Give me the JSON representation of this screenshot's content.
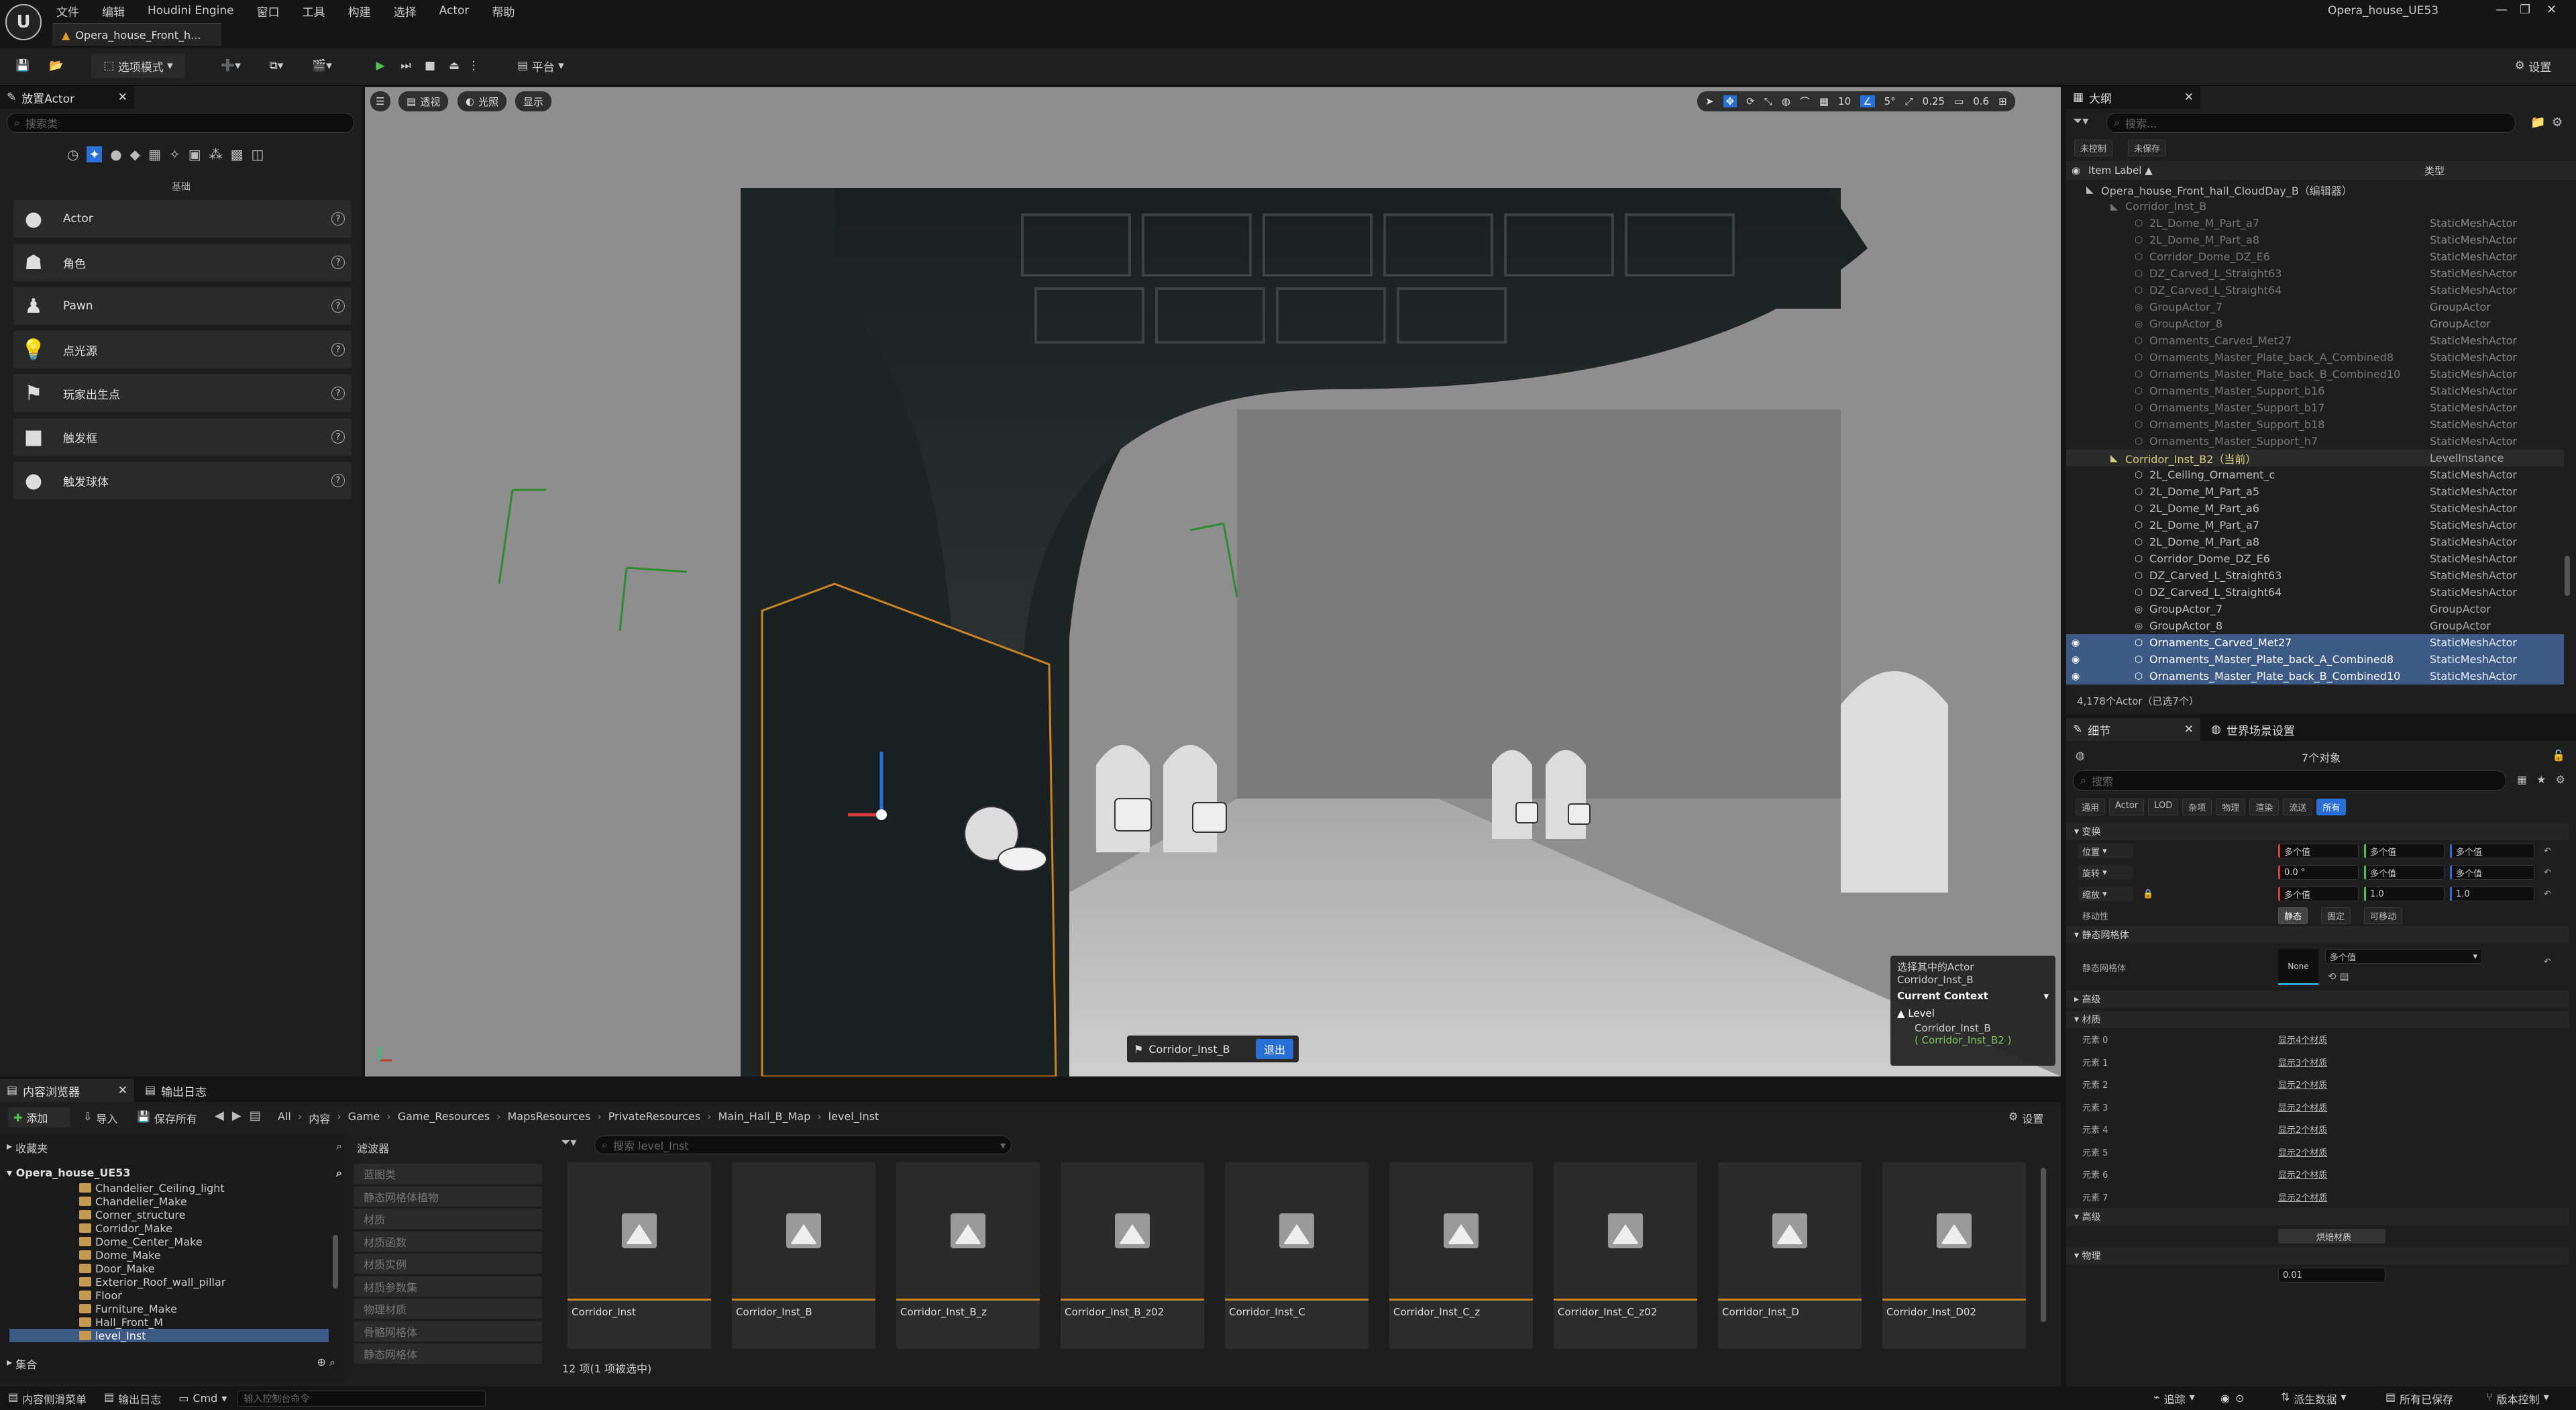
{
  "menu": [
    "文件",
    "编辑",
    "Houdini Engine",
    "窗口",
    "工具",
    "构建",
    "选择",
    "Actor",
    "帮助"
  ],
  "app": {
    "project": "Opera_house_UE53",
    "doc_tab": "Opera_house_Front_h..."
  },
  "toolbar": {
    "mode": "选项模式",
    "platform": "平台",
    "settings": "设置"
  },
  "place": {
    "tab": "放置Actor",
    "search_placeholder": "搜索类",
    "category": "基础",
    "items": [
      {
        "label": "Actor",
        "icon": "sphere-icon"
      },
      {
        "label": "角色",
        "icon": "character-icon"
      },
      {
        "label": "Pawn",
        "icon": "pawn-icon"
      },
      {
        "label": "点光源",
        "icon": "point-light-icon"
      },
      {
        "label": "玩家出生点",
        "icon": "player-start-icon"
      },
      {
        "label": "触发框",
        "icon": "trigger-box-icon"
      },
      {
        "label": "触发球体",
        "icon": "trigger-sphere-icon"
      }
    ]
  },
  "viewport": {
    "perspective": "透视",
    "lit": "光照",
    "show": "显示",
    "grid": "10",
    "angle": "5°",
    "scale": "0.25",
    "camera": "0.6",
    "level_chip": "Corridor_Inst_B",
    "exit_button": "退出",
    "context": {
      "sel_label": "选择其中的Actor",
      "sel_value": "Corridor_Inst_B",
      "title": "Current Context",
      "level": "Level",
      "level_name": "Corridor_Inst_B",
      "level_sub": "( Corridor_Inst_B2 )"
    }
  },
  "outliner": {
    "tab": "大纲",
    "search_placeholder": "搜索...",
    "filter_a": "未控制",
    "filter_b": "未保存",
    "col_label": "Item Label ▲",
    "col_type": "类型",
    "rows": [
      {
        "indent": 1,
        "icon": "◣",
        "name": "Opera_house_Front_hall_CloudDay_B（编辑器）",
        "type": "",
        "style": ""
      },
      {
        "indent": 2,
        "icon": "◣",
        "name": "Corridor_Inst_B",
        "type": "",
        "style": "dim"
      },
      {
        "indent": 3,
        "icon": "⬡",
        "name": "2L_Dome_M_Part_a7",
        "type": "StaticMeshActor",
        "style": "dim"
      },
      {
        "indent": 3,
        "icon": "⬡",
        "name": "2L_Dome_M_Part_a8",
        "type": "StaticMeshActor",
        "style": "dim"
      },
      {
        "indent": 3,
        "icon": "⬡",
        "name": "Corridor_Dome_DZ_E6",
        "type": "StaticMeshActor",
        "style": "dim"
      },
      {
        "indent": 3,
        "icon": "⬡",
        "name": "DZ_Carved_L_Straight63",
        "type": "StaticMeshActor",
        "style": "dim"
      },
      {
        "indent": 3,
        "icon": "⬡",
        "name": "DZ_Carved_L_Straight64",
        "type": "StaticMeshActor",
        "style": "dim"
      },
      {
        "indent": 3,
        "icon": "◎",
        "name": "GroupActor_7",
        "type": "GroupActor",
        "style": "dim"
      },
      {
        "indent": 3,
        "icon": "◎",
        "name": "GroupActor_8",
        "type": "GroupActor",
        "style": "dim"
      },
      {
        "indent": 3,
        "icon": "⬡",
        "name": "Ornaments_Carved_Met27",
        "type": "StaticMeshActor",
        "style": "dim"
      },
      {
        "indent": 3,
        "icon": "⬡",
        "name": "Ornaments_Master_Plate_back_A_Combined8",
        "type": "StaticMeshActor",
        "style": "dim"
      },
      {
        "indent": 3,
        "icon": "⬡",
        "name": "Ornaments_Master_Plate_back_B_Combined10",
        "type": "StaticMeshActor",
        "style": "dim"
      },
      {
        "indent": 3,
        "icon": "⬡",
        "name": "Ornaments_Master_Support_b16",
        "type": "StaticMeshActor",
        "style": "dim"
      },
      {
        "indent": 3,
        "icon": "⬡",
        "name": "Ornaments_Master_Support_b17",
        "type": "StaticMeshActor",
        "style": "dim"
      },
      {
        "indent": 3,
        "icon": "⬡",
        "name": "Ornaments_Master_Support_b18",
        "type": "StaticMeshActor",
        "style": "dim"
      },
      {
        "indent": 3,
        "icon": "⬡",
        "name": "Ornaments_Master_Support_h7",
        "type": "StaticMeshActor",
        "style": "dim"
      },
      {
        "indent": 2,
        "icon": "◣",
        "name": "Corridor_Inst_B2（当前）",
        "type": "LevelInstance",
        "style": "cur"
      },
      {
        "indent": 3,
        "icon": "⬡",
        "name": "2L_Ceiling_Ornament_c",
        "type": "StaticMeshActor",
        "style": ""
      },
      {
        "indent": 3,
        "icon": "⬡",
        "name": "2L_Dome_M_Part_a5",
        "type": "StaticMeshActor",
        "style": ""
      },
      {
        "indent": 3,
        "icon": "⬡",
        "name": "2L_Dome_M_Part_a6",
        "type": "StaticMeshActor",
        "style": ""
      },
      {
        "indent": 3,
        "icon": "⬡",
        "name": "2L_Dome_M_Part_a7",
        "type": "StaticMeshActor",
        "style": ""
      },
      {
        "indent": 3,
        "icon": "⬡",
        "name": "2L_Dome_M_Part_a8",
        "type": "StaticMeshActor",
        "style": ""
      },
      {
        "indent": 3,
        "icon": "⬡",
        "name": "Corridor_Dome_DZ_E6",
        "type": "StaticMeshActor",
        "style": ""
      },
      {
        "indent": 3,
        "icon": "⬡",
        "name": "DZ_Carved_L_Straight63",
        "type": "StaticMeshActor",
        "style": ""
      },
      {
        "indent": 3,
        "icon": "⬡",
        "name": "DZ_Carved_L_Straight64",
        "type": "StaticMeshActor",
        "style": ""
      },
      {
        "indent": 3,
        "icon": "◎",
        "name": "GroupActor_7",
        "type": "GroupActor",
        "style": ""
      },
      {
        "indent": 3,
        "icon": "◎",
        "name": "GroupActor_8",
        "type": "GroupActor",
        "style": ""
      },
      {
        "indent": 3,
        "icon": "⬡",
        "name": "Ornaments_Carved_Met27",
        "type": "StaticMeshActor",
        "style": "sel"
      },
      {
        "indent": 3,
        "icon": "⬡",
        "name": "Ornaments_Master_Plate_back_A_Combined8",
        "type": "StaticMeshActor",
        "style": "sel"
      },
      {
        "indent": 3,
        "icon": "⬡",
        "name": "Ornaments_Master_Plate_back_B_Combined10",
        "type": "StaticMeshActor",
        "style": "sel"
      }
    ],
    "count": "4,178个Actor（已选7个）"
  },
  "details": {
    "tab": "细节",
    "tab2": "世界场景设置",
    "objects": "7个对象",
    "search_placeholder": "搜索",
    "filters": [
      "通用",
      "Actor",
      "LOD",
      "杂项",
      "物理",
      "渲染",
      "流送",
      "所有"
    ],
    "sec_transform": "变换",
    "location": {
      "label": "位置",
      "x": "多个值",
      "y": "多个值",
      "z": "多个值"
    },
    "rotation": {
      "label": "旋转",
      "x": "0.0 °",
      "y": "多个值",
      "z": "多个值"
    },
    "scale": {
      "label": "缩放",
      "x": "多个值",
      "y": "1.0",
      "z": "1.0"
    },
    "mobility": {
      "label": "移动性",
      "a": "静态",
      "b": "固定",
      "c": "可移动"
    },
    "sec_mesh": "静态网格体",
    "mesh_label": "静态网格体",
    "mesh_none": "None",
    "mesh_value": "多个值",
    "sec_advanced": "高级",
    "sec_material": "材质",
    "materials": [
      {
        "label": "元素 0",
        "value": "显示4个材质"
      },
      {
        "label": "元素 1",
        "value": "显示3个材质"
      },
      {
        "label": "元素 2",
        "value": "显示2个材质"
      },
      {
        "label": "元素 3",
        "value": "显示2个材质"
      },
      {
        "label": "元素 4",
        "value": "显示2个材质"
      },
      {
        "label": "元素 5",
        "value": "显示2个材质"
      },
      {
        "label": "元素 6",
        "value": "显示2个材质"
      },
      {
        "label": "元素 7",
        "value": "显示2个材质"
      }
    ],
    "sec_adv2": "高级",
    "bake": "烘焙材质",
    "sec_physics": "物理",
    "phys_value": "0.01"
  },
  "content": {
    "tab": "内容浏览器",
    "tab2": "输出日志",
    "add": "添加",
    "import": "导入",
    "save_all": "保存所有",
    "path": [
      "All",
      "内容",
      "Game",
      "Game_Resources",
      "MapsResources",
      "PrivateResources",
      "Main_Hall_B_Map",
      "level_Inst"
    ],
    "settings": "设置",
    "favorites": "收藏夹",
    "project": "Opera_house_UE53",
    "folders": [
      "Chandelier_Ceiling_light",
      "Chandelier_Make",
      "Corner_structure",
      "Corridor_Make",
      "Dome_Center_Make",
      "Dome_Make",
      "Door_Make",
      "Exterior_Roof_wall_pillar",
      "Floor",
      "Furniture_Make",
      "Hall_Front_M",
      "level_Inst"
    ],
    "collections": "集合",
    "filters_title": "滤波器",
    "filters": [
      "蓝图类",
      "静态网格体植物",
      "材质",
      "材质函数",
      "材质实例",
      "材质参数集",
      "物理材质",
      "骨骼网格体",
      "静态网格体"
    ],
    "search_placeholder": "搜索 level_Inst",
    "assets": [
      "Corridor_Inst",
      "Corridor_Inst_B",
      "Corridor_Inst_B_z",
      "Corridor_Inst_B_z02",
      "Corridor_Inst_C",
      "Corridor_Inst_C_z",
      "Corridor_Inst_C_z02",
      "Corridor_Inst_D",
      "Corridor_Inst_D02"
    ],
    "count": "12 项(1 项被选中)"
  },
  "status": {
    "drawer": "内容侧滑菜单",
    "log": "输出日志",
    "cmd": "Cmd",
    "cmd_placeholder": "输入控制台命令",
    "trace": "追踪",
    "derived": "派生数据",
    "saved": "所有已保存",
    "source": "版本控制"
  },
  "colors": {
    "accent": "#2a6fd6",
    "selection": "#3d5a86",
    "orange": "#c78420",
    "viewport_bg": "#8f8f8f"
  }
}
